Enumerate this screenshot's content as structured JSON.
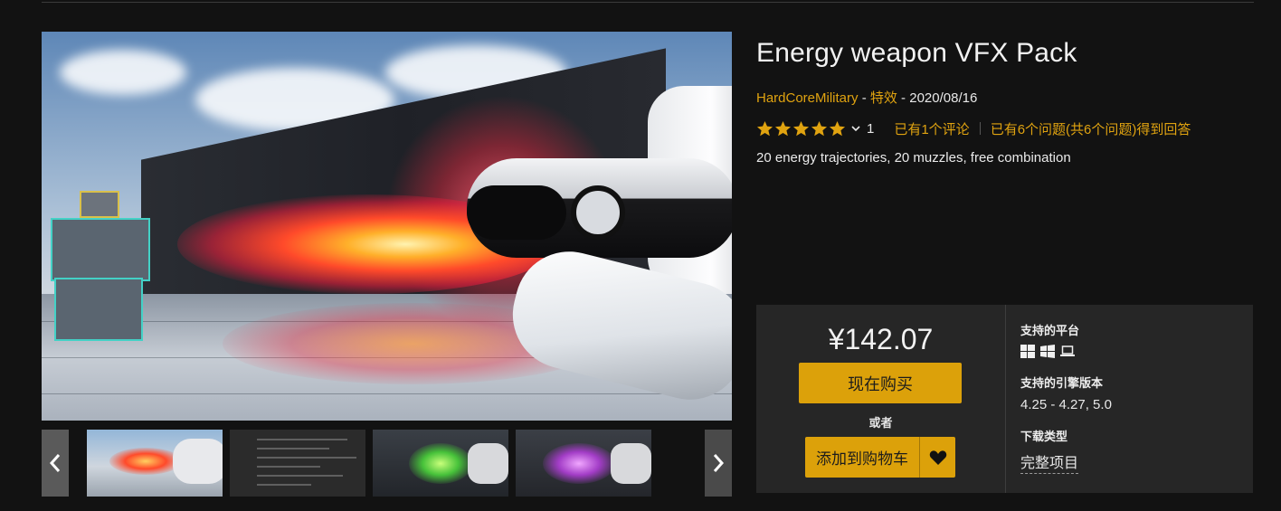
{
  "product": {
    "title": "Energy weapon VFX Pack",
    "seller": "HardCoreMilitary",
    "separator1": " - ",
    "category": "特效",
    "separator2": " - ",
    "date": "2020/08/16",
    "rating_stars": 5,
    "rating_count": "1",
    "reviews_link": "已有1个评论",
    "questions_link": "已有6个问题(共6个问题)得到回答",
    "description": "20 energy trajectories, 20 muzzles, free combination"
  },
  "gallery": {
    "thumbnails": [
      "flame-thumbnail",
      "editor-thumbnail",
      "green-fx-thumbnail",
      "purple-fx-thumbnail"
    ],
    "prev_icon": "chevron-left-icon",
    "next_icon": "chevron-right-icon"
  },
  "purchase": {
    "price": "¥142.07",
    "buy_now_label": "现在购买",
    "or_label": "或者",
    "add_to_cart_label": "添加到购物车",
    "wishlist_icon": "heart-icon",
    "accent_color": "#dca10a"
  },
  "specs": {
    "platforms_label": "支持的平台",
    "platform_icons": [
      "windows-icon",
      "windows-icon",
      "laptop-icon"
    ],
    "engine_label": "支持的引擎版本",
    "engine_versions": "4.25 - 4.27, 5.0",
    "download_label": "下载类型",
    "download_type": "完整项目"
  }
}
